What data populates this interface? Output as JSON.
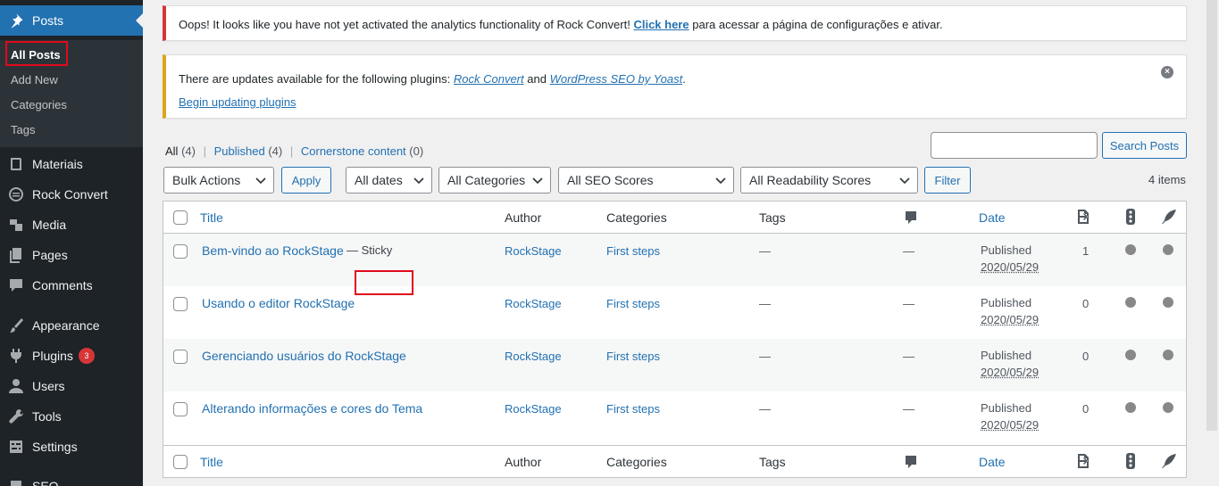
{
  "sidebar": {
    "posts": "Posts",
    "submenu": [
      "All Posts",
      "Add New",
      "Categories",
      "Tags"
    ],
    "items": [
      "Materiais",
      "Rock Convert",
      "Media",
      "Pages",
      "Comments",
      "Appearance",
      "Plugins",
      "Users",
      "Tools",
      "Settings",
      "SEO"
    ],
    "plugins_badge": "3"
  },
  "notices": {
    "error_text": "Oops! It looks like you have not yet activated the analytics functionality of Rock Convert!",
    "error_link": "Click here",
    "error_after": "para acessar a página de configurações e ativar.",
    "update_text": "There are updates available for the following plugins:",
    "update_plugin1": "Rock Convert",
    "update_and": "and",
    "update_plugin2": "WordPress SEO by Yoast",
    "update_period": ".",
    "update_link": "Begin updating plugins"
  },
  "views": {
    "all": "All",
    "all_count": "(4)",
    "published": "Published",
    "published_count": "(4)",
    "cornerstone": "Cornerstone content",
    "cornerstone_count": "(0)",
    "sep": "|"
  },
  "search": {
    "button": "Search Posts",
    "value": ""
  },
  "filters": {
    "bulk": "Bulk Actions",
    "apply": "Apply",
    "dates": "All dates",
    "categories": "All Categories",
    "seo": "All SEO Scores",
    "readability": "All Readability Scores",
    "filter": "Filter",
    "items": "4 items"
  },
  "columns": {
    "title": "Title",
    "author": "Author",
    "categories": "Categories",
    "tags": "Tags",
    "date": "Date"
  },
  "sticky_label": "— Sticky",
  "posts": [
    {
      "title": "Bem-vindo ao RockStage",
      "author": "RockStage",
      "category": "First steps",
      "tags": "—",
      "comments": "—",
      "status": "Published",
      "date": "2020/05/29",
      "links": "1"
    },
    {
      "title": "Usando o editor RockStage",
      "author": "RockStage",
      "category": "First steps",
      "tags": "—",
      "comments": "—",
      "status": "Published",
      "date": "2020/05/29",
      "links": "0"
    },
    {
      "title": "Gerenciando usuários do RockStage",
      "author": "RockStage",
      "category": "First steps",
      "tags": "—",
      "comments": "—",
      "status": "Published",
      "date": "2020/05/29",
      "links": "0"
    },
    {
      "title": "Alterando informações e cores do Tema",
      "author": "RockStage",
      "category": "First steps",
      "tags": "—",
      "comments": "—",
      "status": "Published",
      "date": "2020/05/29",
      "links": "0"
    }
  ],
  "icons": {
    "comments_col": "comment-bubble-icon",
    "links_col": "internal-links-icon",
    "seo_col": "seo-traffic-light-icon",
    "readability_col": "readability-feather-icon"
  }
}
